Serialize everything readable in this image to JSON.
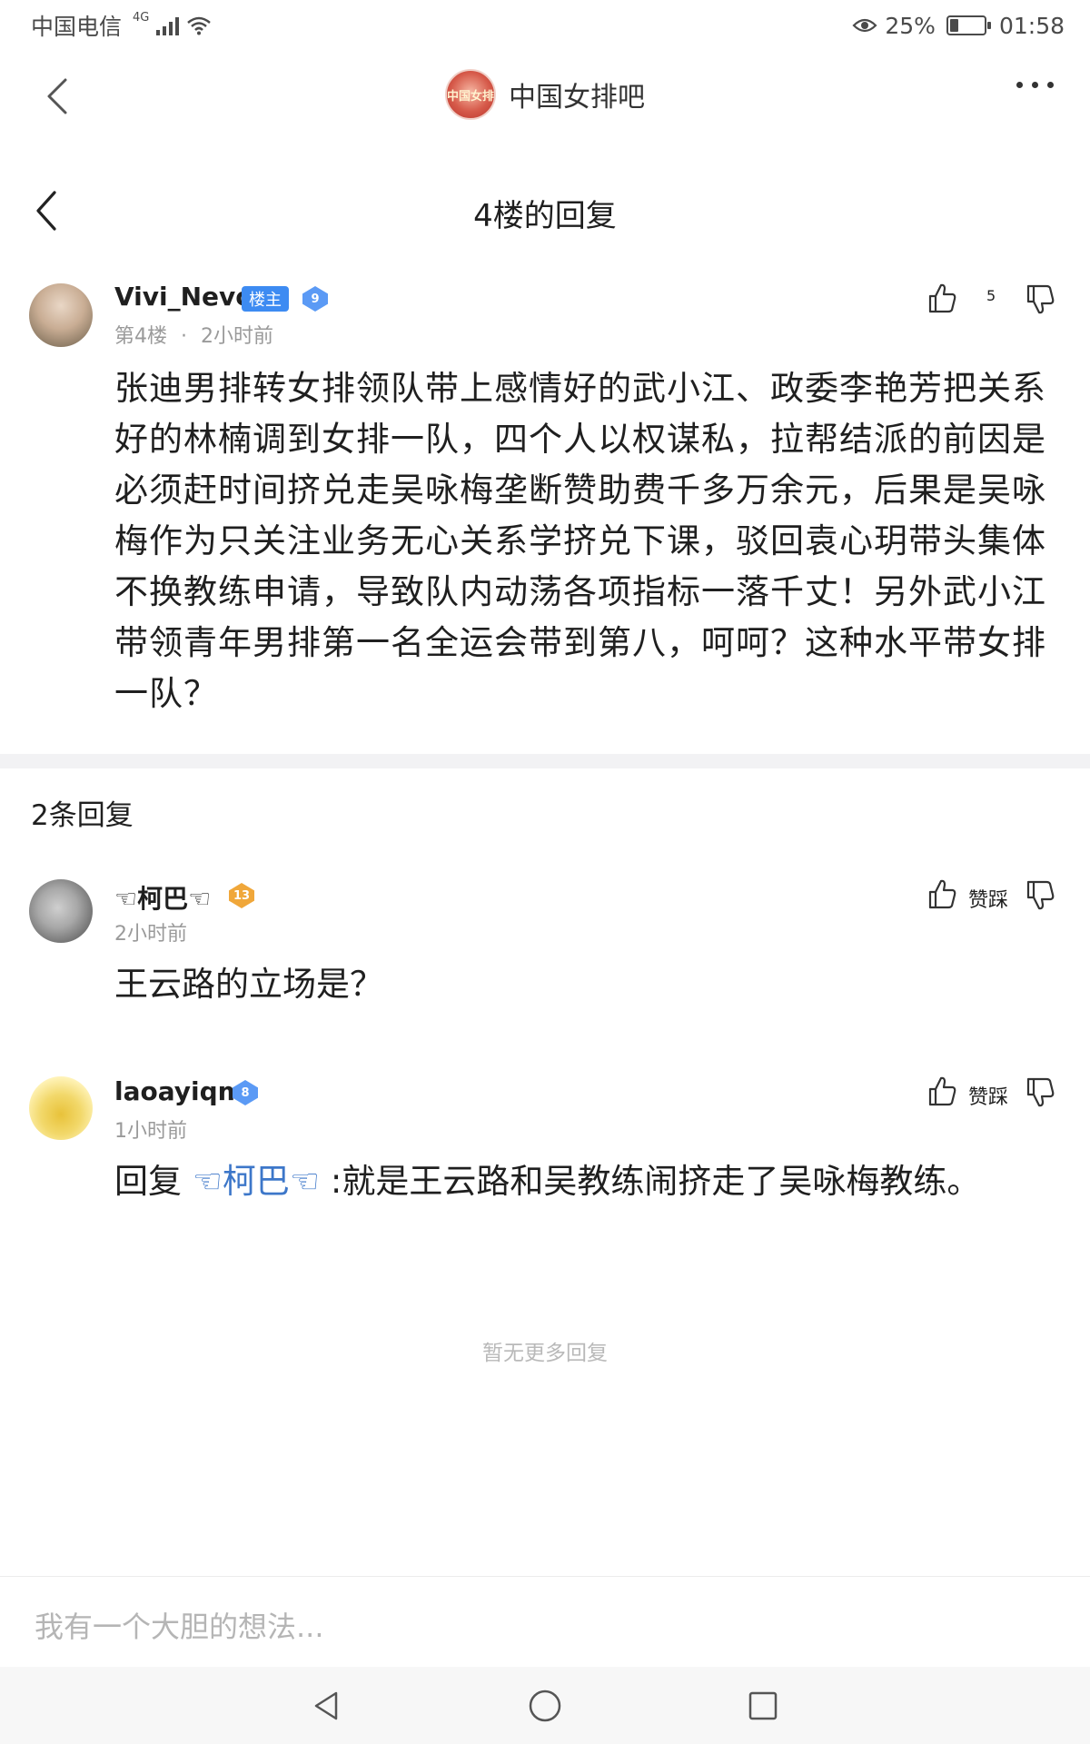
{
  "status_bar": {
    "carrier": "中国电信",
    "network": "4G",
    "battery": "25%",
    "battery_level": 0.25,
    "time": "01:58"
  },
  "top_bar": {
    "forum_name": "中国女排吧",
    "forum_avatar_text": "中国女排"
  },
  "sub_header": {
    "title": "4楼的回复"
  },
  "post": {
    "username": "Vivi_Nevo",
    "op_badge": "楼主",
    "level": "9",
    "floor": "第4楼",
    "separator": "·",
    "time": "2小时前",
    "like_count": "5",
    "body": "张迪男排转女排领队带上感情好的武小江、政委李艳芳把关系好的林楠调到女排一队，四个人以权谋私，拉帮结派的前因是必须赶时间挤兑走吴咏梅垄断赞助费千多万余元，后果是吴咏梅作为只关注业务无心关系学挤兑下课，驳回袁心玥带头集体不换教练申请，导致队内动荡各项指标一落千丈！另外武小江带领青年男排第一名全运会带到第八，呵呵？这种水平带女排一队？"
  },
  "replies_header": "2条回复",
  "replies": [
    {
      "username": "☜柯巴☜",
      "level": "13",
      "time": "2小时前",
      "vote_label": "赞踩",
      "body": "王云路的立场是？"
    },
    {
      "username": "laoayiqm",
      "level": "8",
      "time": "1小时前",
      "vote_label": "赞踩",
      "reply_prefix": "回复",
      "mention": "☜柯巴☜",
      "body": " :就是王云路和吴教练闹挤走了吴咏梅教练。"
    }
  ],
  "no_more_text": "暂无更多回复",
  "input": {
    "placeholder": "我有一个大胆的想法..."
  },
  "colors": {
    "accent_blue": "#3d8bf2",
    "mention_blue": "#3d77c9",
    "level_gold": "#f0a73a"
  }
}
